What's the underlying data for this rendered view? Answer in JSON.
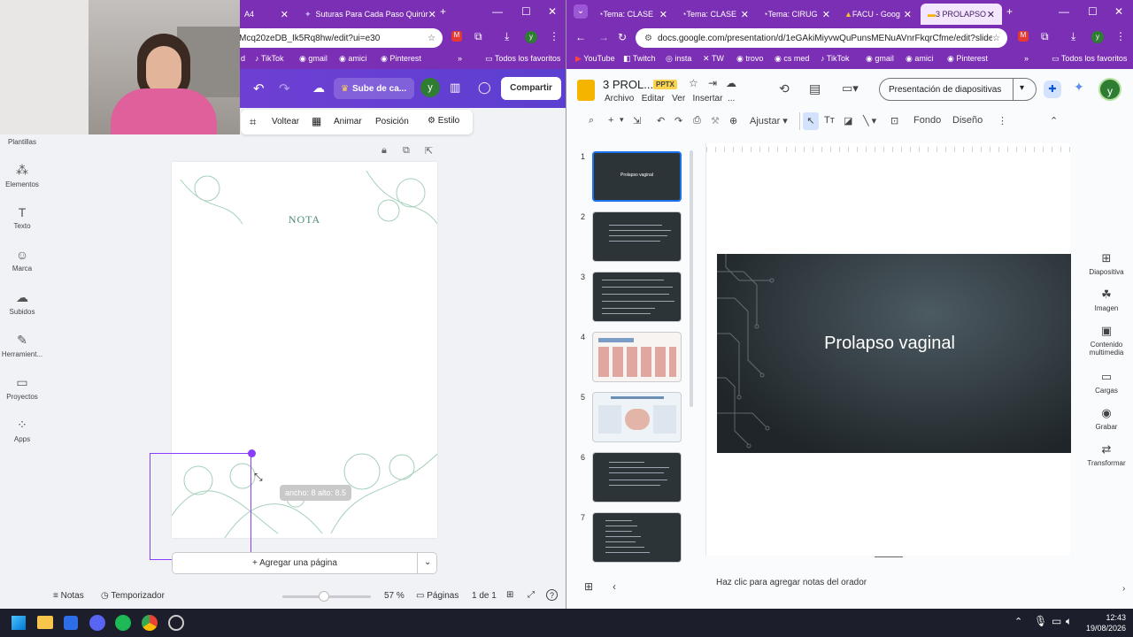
{
  "left_window": {
    "tabs": [
      {
        "label": "A4",
        "active": false
      },
      {
        "label": "Suturas Para Cada Paso Quirúr",
        "active": false
      }
    ],
    "url": "Mcq20zeDB_Ik5Rq8hw/edit?ui=e30",
    "bookmarks": [
      "TikTok",
      "gmail",
      "amici",
      "Pinterest"
    ],
    "bookmarks_folder": "Todos los favoritos",
    "canva_header": {
      "design_title": "Sube de ca...",
      "avatar_letter": "y",
      "share_label": "Compartir"
    },
    "toolbar": {
      "flip": "Voltear",
      "animate": "Animar",
      "position": "Posición",
      "style": "Estilo"
    },
    "side_panel": [
      {
        "label": "Plantillas",
        "icon": "templates-icon"
      },
      {
        "label": "Elementos",
        "icon": "elements-icon"
      },
      {
        "label": "Texto",
        "icon": "text-icon"
      },
      {
        "label": "Marca",
        "icon": "brand-icon"
      },
      {
        "label": "Subidos",
        "icon": "upload-icon"
      },
      {
        "label": "Herramient...",
        "icon": "tools-icon"
      },
      {
        "label": "Proyectos",
        "icon": "projects-icon"
      },
      {
        "label": "Apps",
        "icon": "apps-icon"
      }
    ],
    "page_heading": "NOTA",
    "size_tooltip": "ancho: 8 alto: 8.5",
    "add_page": "+ Agregar una página",
    "status": {
      "notes": "Notas",
      "timer": "Temporizador",
      "zoom": "57 %",
      "pages_label": "Páginas",
      "page_count": "1 de 1"
    }
  },
  "right_window": {
    "tabs": [
      {
        "label": "Tema: CLASE",
        "active": false
      },
      {
        "label": "Tema: CLASE",
        "active": false
      },
      {
        "label": "Tema: CIRUG",
        "active": false
      },
      {
        "label": "FACU - Goog",
        "active": false
      },
      {
        "label": "3 PROLAPSO",
        "active": true
      }
    ],
    "url": "docs.google.com/presentation/d/1eGAkiMiyvwQuPunsMENuAVnrFkqrCfme/edit?slide=...",
    "bookmarks": [
      "YouTube",
      "Twitch",
      "insta",
      "TW",
      "trovo",
      "cs med",
      "TikTok",
      "gmail",
      "amici",
      "Pinterest"
    ],
    "bookmarks_folder": "Todos los favoritos",
    "doc_title": "3 PROL...",
    "file_badge": "PPTX",
    "menus": [
      "Archivo",
      "Editar",
      "Ver",
      "Insertar",
      "..."
    ],
    "slideshow_button": "Presentación de diapositivas",
    "avatar_letter": "y",
    "toolbar": {
      "fit": "Ajustar",
      "background": "Fondo",
      "layout": "Diseño"
    },
    "slides": [
      {
        "num": "1",
        "title": "Prolapso vaginal"
      },
      {
        "num": "2",
        "title": ""
      },
      {
        "num": "3",
        "title": ""
      },
      {
        "num": "4",
        "title": ""
      },
      {
        "num": "5",
        "title": ""
      },
      {
        "num": "6",
        "title": ""
      },
      {
        "num": "7",
        "title": ""
      }
    ],
    "main_slide_title": "Prolapso vaginal",
    "speaker_notes_placeholder": "Haz clic para agregar notas del orador",
    "side_panel": [
      {
        "label": "Diapositiva",
        "icon": "add-slide-icon"
      },
      {
        "label": "Imagen",
        "icon": "image-icon"
      },
      {
        "label": "Contenido multimedia",
        "icon": "media-icon"
      },
      {
        "label": "Cargas",
        "icon": "uploads-icon"
      },
      {
        "label": "Grabar",
        "icon": "record-icon"
      },
      {
        "label": "Transformar",
        "icon": "transform-icon"
      }
    ]
  },
  "taskbar": {
    "time": "12:43",
    "date": "19/08/2026"
  },
  "colors": {
    "browser_purple": "#7b2fb4",
    "canva_gradient": "#7d3fd6",
    "slide_dark": "#2d3438",
    "accent_blue": "#1a73e8"
  }
}
